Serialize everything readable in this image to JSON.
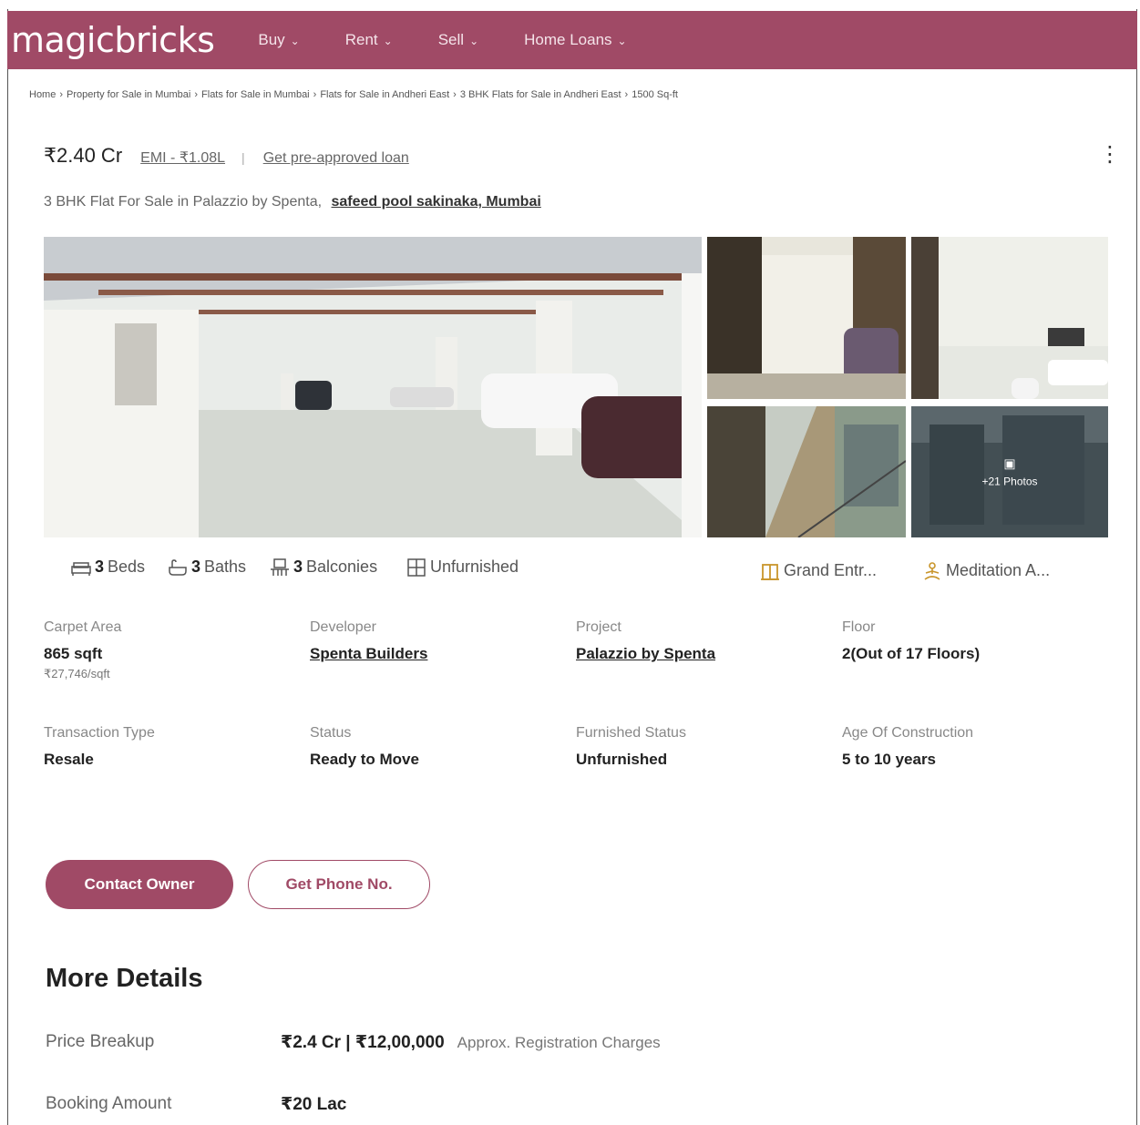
{
  "brand": {
    "logo": "magicbricks",
    "color": "#a04a66"
  },
  "nav": {
    "items": [
      {
        "label": "Buy"
      },
      {
        "label": "Rent"
      },
      {
        "label": "Sell"
      },
      {
        "label": "Home Loans"
      }
    ]
  },
  "breadcrumb": [
    "Home",
    "Property for Sale in Mumbai",
    "Flats for Sale in Mumbai",
    "Flats for Sale in Andheri East",
    "3 BHK Flats for Sale in Andheri East",
    "1500 Sq-ft"
  ],
  "listing": {
    "price": "₹2.40 Cr",
    "emi": "EMI - ₹1.08L",
    "loan_link": "Get pre-approved loan",
    "title": "3 BHK Flat For Sale in Palazzio by Spenta,",
    "location": "safeed pool sakinaka, Mumbai",
    "more_photos": "+21 Photos"
  },
  "features": {
    "beds_count": "3",
    "beds_label": "Beds",
    "baths_count": "3",
    "baths_label": "Baths",
    "balconies_count": "3",
    "balconies_label": "Balconies",
    "furnishing": "Unfurnished",
    "amenity_1": "Grand Entr...",
    "amenity_2": "Meditation A..."
  },
  "summary": {
    "carpet_area_label": "Carpet Area",
    "carpet_area_value": "865 sqft",
    "carpet_area_rate": "₹27,746/sqft",
    "developer_label": "Developer",
    "developer_value": "Spenta Builders",
    "project_label": "Project",
    "project_value": "Palazzio by Spenta",
    "floor_label": "Floor",
    "floor_value": "2(Out of 17 Floors)",
    "transaction_label": "Transaction Type",
    "transaction_value": "Resale",
    "status_label": "Status",
    "status_value": "Ready to Move",
    "furnished_label": "Furnished Status",
    "furnished_value": "Unfurnished",
    "age_label": "Age Of Construction",
    "age_value": "5 to 10 years"
  },
  "actions": {
    "contact_owner": "Contact Owner",
    "get_phone": "Get Phone No."
  },
  "more_details": {
    "title": "More Details",
    "price_breakup_label": "Price Breakup",
    "price_breakup_value": "₹2.4 Cr | ₹12,00,000",
    "price_breakup_note": "Approx. Registration Charges",
    "booking_label": "Booking Amount",
    "booking_value": "₹20 Lac"
  }
}
